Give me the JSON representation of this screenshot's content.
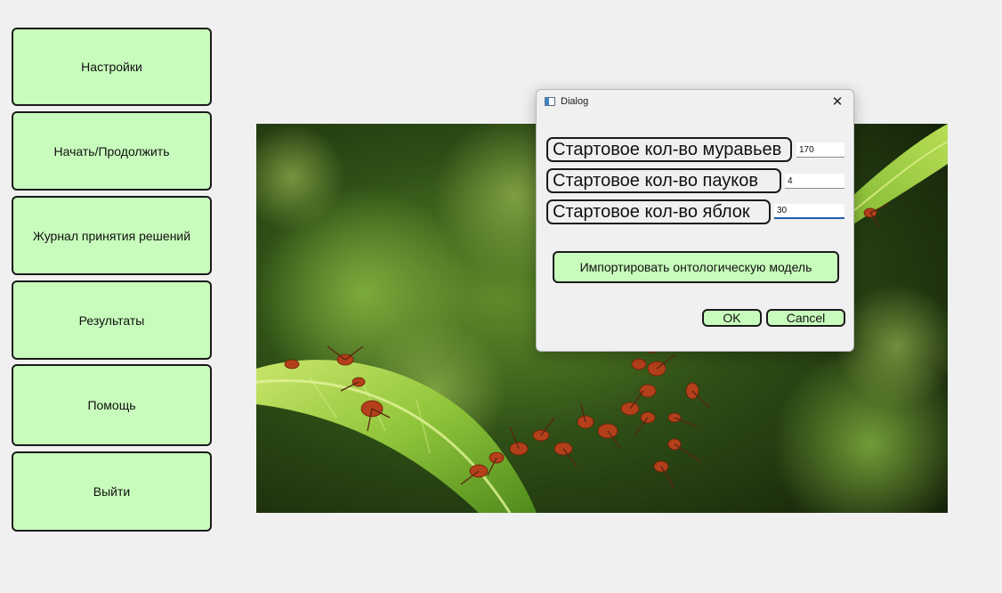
{
  "menu": {
    "items": [
      {
        "label": "Настройки"
      },
      {
        "label": "Начать/Продолжить"
      },
      {
        "label": "Журнал принятия решений"
      },
      {
        "label": "Результаты"
      },
      {
        "label": "Помощь"
      },
      {
        "label": "Выйти"
      }
    ]
  },
  "photo": {
    "icon": "ants-bridge-photo"
  },
  "dialog": {
    "title": "Dialog",
    "close_icon": "close-icon",
    "fields": [
      {
        "label": "Стартовое кол-во муравьев",
        "value": "170"
      },
      {
        "label": "Стартовое кол-во пауков",
        "value": "4"
      },
      {
        "label": "Стартовое кол-во яблок",
        "value": "30"
      }
    ],
    "import_label": "Импортировать онтологическую модель",
    "ok_label": "OK",
    "cancel_label": "Cancel"
  },
  "colors": {
    "button_bg": "#c8fcbc",
    "background": "#f0f0f0",
    "focus_underline": "#1f5fa8"
  }
}
